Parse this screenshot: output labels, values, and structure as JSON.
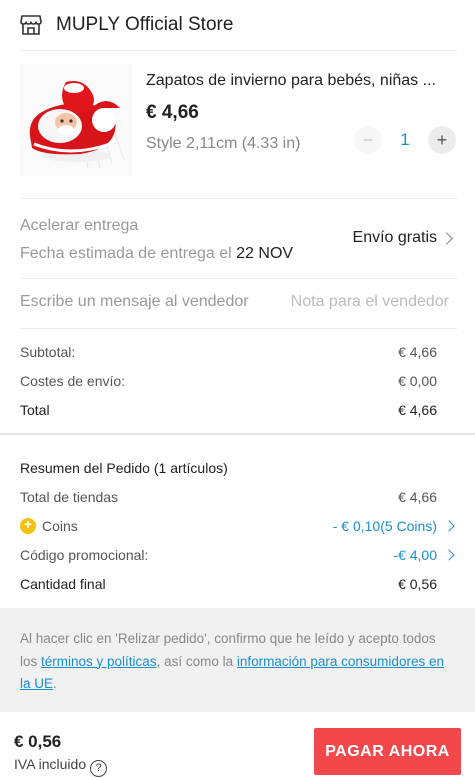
{
  "store": {
    "name": "MUPLY Official Store",
    "icon": "store-icon"
  },
  "product": {
    "title": "Zapatos de invierno para bebés, niñas ...",
    "price": "€ 4,66",
    "style": "Style 2,11cm (4.33 in)",
    "quantity": "1",
    "minus_label": "−",
    "plus_label": "+"
  },
  "shipping": {
    "label": "Acelerar entrega",
    "estimate_prefix": "Fecha estimada de entrega el ",
    "estimate_date": "22 NOV",
    "method": "Envío gratis"
  },
  "message": {
    "label": "Escribe un mensaje al vendedor",
    "placeholder": "Nota para el vendedor",
    "value": ""
  },
  "summary": {
    "subtotal_label": "Subtotal:",
    "subtotal_value": "€ 4,66",
    "shipping_label": "Costes de envío:",
    "shipping_value": "€ 0,00",
    "total_label": "Total",
    "total_value": "€ 4,66"
  },
  "order": {
    "title": "Resumen del Pedido (1 artículos)",
    "stores_label": "Total de tiendas",
    "stores_value": "€ 4,66",
    "coins_label": "Coins",
    "coins_value": "- € 0,10(5 Coins)",
    "promo_label": "Código promocional:",
    "promo_value": "-€ 4,00",
    "final_label": "Cantidad final",
    "final_value": "€ 0,56"
  },
  "legal": {
    "text_1": "Al hacer clic en 'Relizar pedido', confirmo que he leído y acepto todos los ",
    "link_terms": "términos y políticas",
    "text_2": ", así como la ",
    "link_info": "información para consumidores en la UE",
    "text_3": "."
  },
  "footer": {
    "amount": "€ 0,56",
    "tax_note": "IVA incluido",
    "help_glyph": "?",
    "pay_label": "PAGAR AHORA"
  },
  "colors": {
    "accent_blue": "#1a8fd0",
    "pay_button": "#f2484c",
    "coin": "#f4c20d"
  }
}
